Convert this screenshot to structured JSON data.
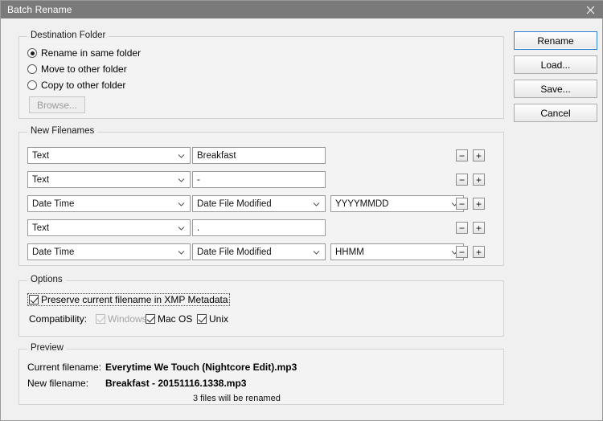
{
  "window": {
    "title": "Batch Rename",
    "close_icon": "close-icon"
  },
  "destination": {
    "group_title": "Destination Folder",
    "options": [
      {
        "label": "Rename in same folder",
        "selected": true
      },
      {
        "label": "Move to other folder",
        "selected": false
      },
      {
        "label": "Copy to other folder",
        "selected": false
      }
    ],
    "browse_label": "Browse...",
    "browse_disabled": true
  },
  "actions": {
    "rename_label": "Rename",
    "load_label": "Load...",
    "save_label": "Save...",
    "cancel_label": "Cancel"
  },
  "new_filenames": {
    "group_title": "New Filenames",
    "remove_icon": "minus-icon",
    "add_icon": "plus-icon",
    "remove_label": "−",
    "add_label": "+",
    "rows": [
      {
        "type": "Text",
        "value": "Breakfast",
        "format": null
      },
      {
        "type": "Text",
        "value": "-",
        "format": null
      },
      {
        "type": "Date Time",
        "value": "Date File Modified",
        "format": "YYYYMMDD"
      },
      {
        "type": "Text",
        "value": ".",
        "format": null
      },
      {
        "type": "Date Time",
        "value": "Date File Modified",
        "format": "HHMM"
      }
    ]
  },
  "options": {
    "group_title": "Options",
    "preserve_label": "Preserve current filename in XMP Metadata",
    "preserve_checked": true,
    "compatibility_label": "Compatibility:",
    "compatibility": [
      {
        "label": "Windows",
        "checked": true,
        "disabled": true
      },
      {
        "label": "Mac OS",
        "checked": true,
        "disabled": false
      },
      {
        "label": "Unix",
        "checked": true,
        "disabled": false
      }
    ]
  },
  "preview": {
    "group_title": "Preview",
    "current_label": "Current filename:",
    "current_value": "Everytime We Touch (Nightcore Edit).mp3",
    "new_label": "New filename:",
    "new_value": "Breakfast - 20151116.1338.mp3",
    "note": "3 files will be renamed"
  }
}
